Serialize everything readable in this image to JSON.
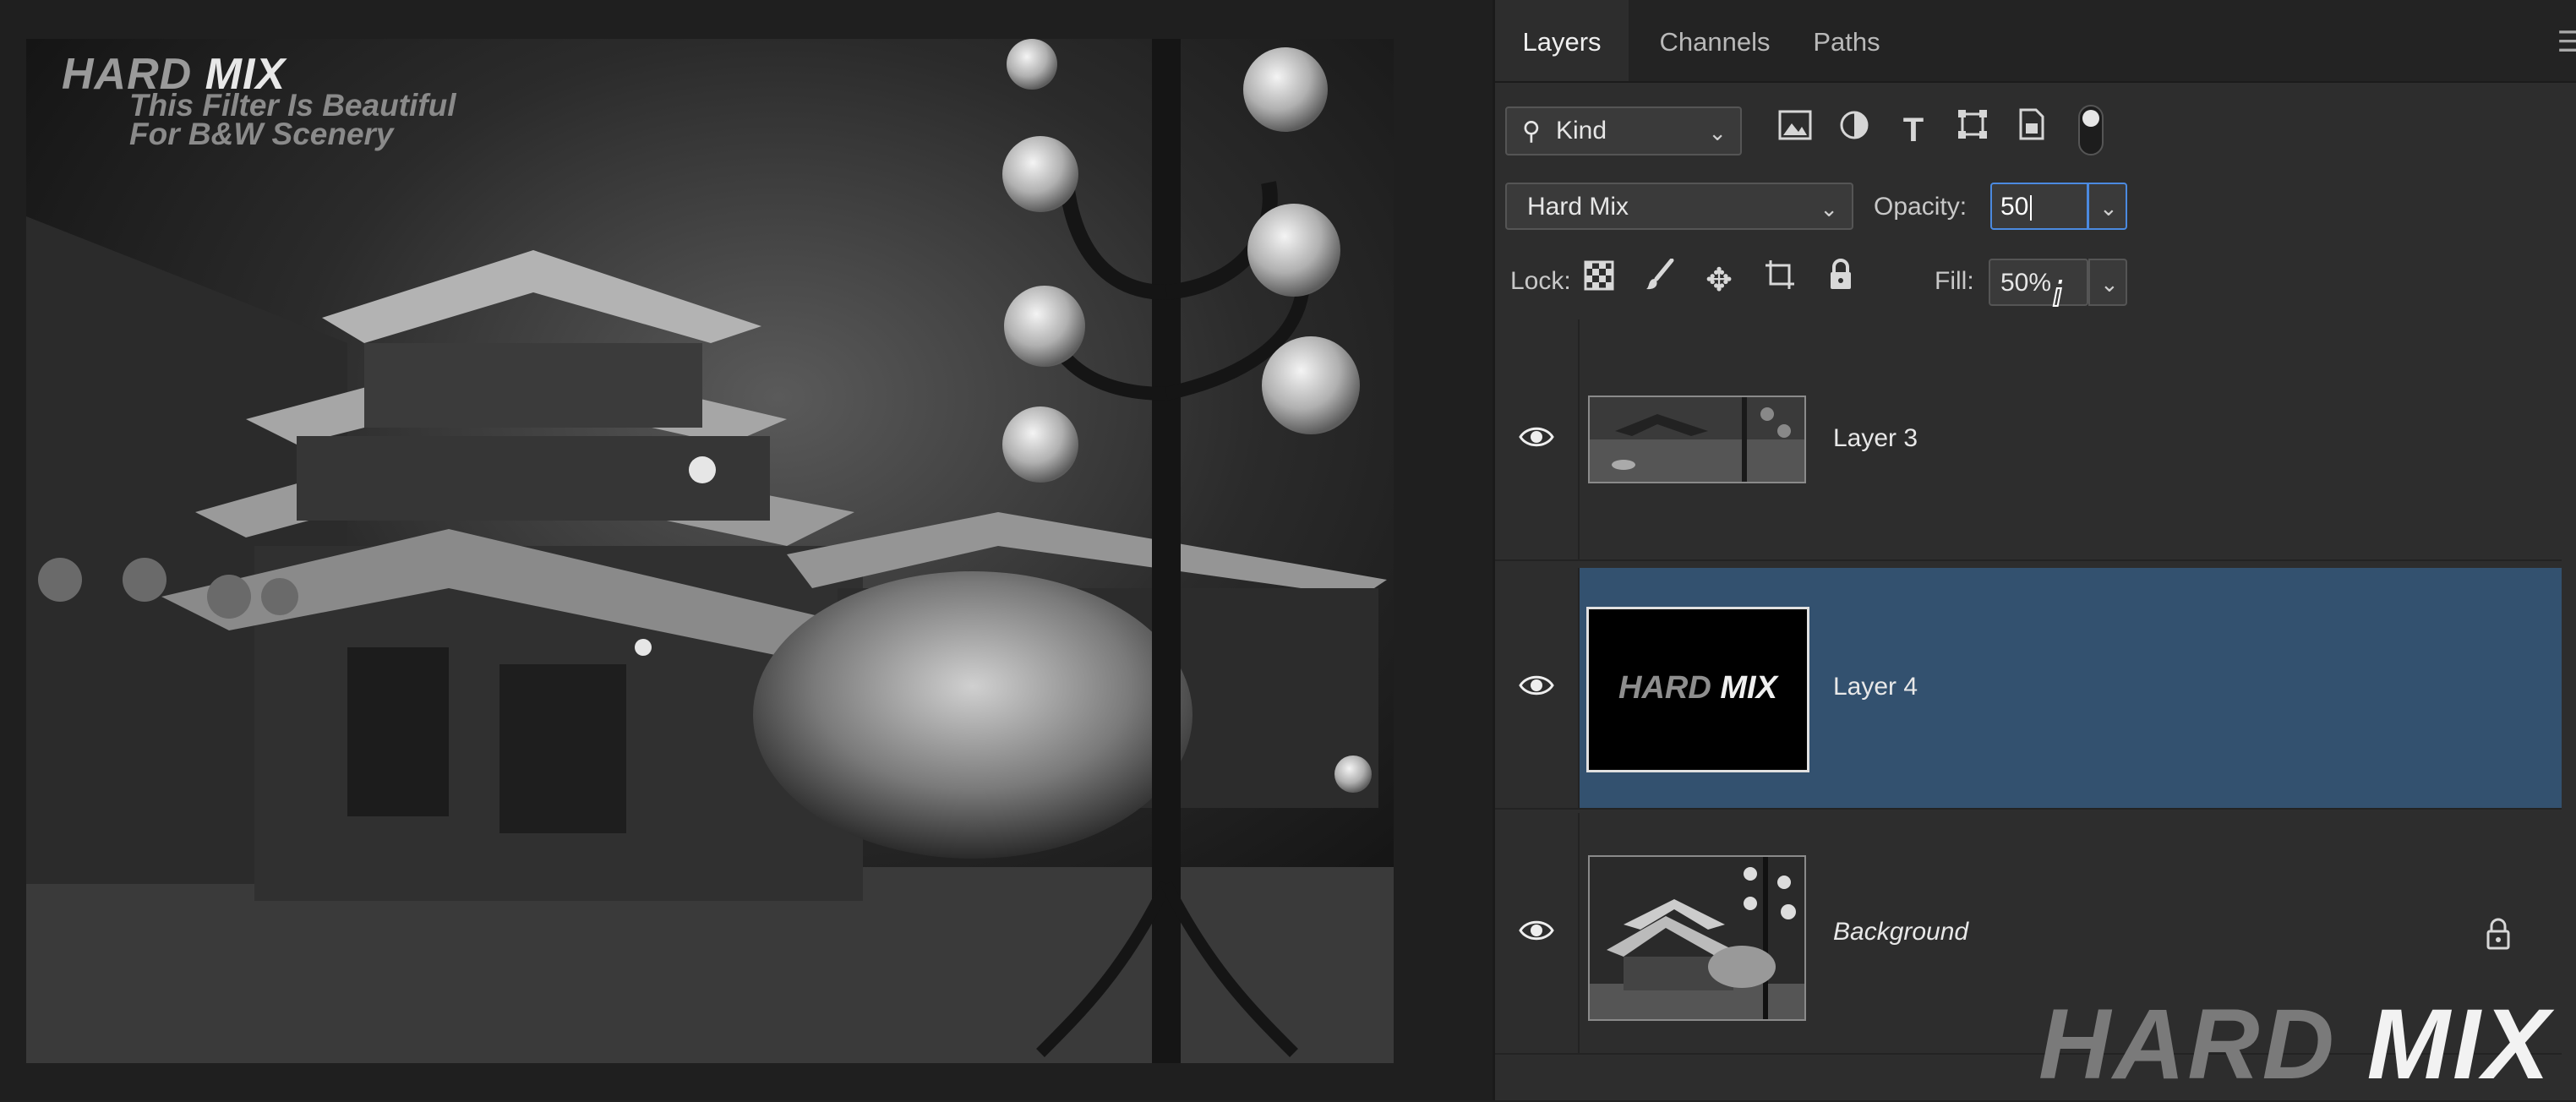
{
  "canvas": {
    "overlay": {
      "title_part1": "HARD",
      "title_part2": "MIX",
      "subtitle_line1": "This Filter Is Beautiful",
      "subtitle_line2": "For B&W Scenery"
    }
  },
  "panel": {
    "tabs": [
      {
        "label": "Layers",
        "active": true
      },
      {
        "label": "Channels",
        "active": false
      },
      {
        "label": "Paths",
        "active": false
      }
    ],
    "filter": {
      "kind_label": "Kind",
      "icons": [
        "image-filter-icon",
        "adjustment-filter-icon",
        "type-filter-icon",
        "shape-filter-icon",
        "smart-object-filter-icon"
      ]
    },
    "blend_mode": "Hard Mix",
    "opacity_label": "Opacity:",
    "opacity_value": "50",
    "lock_label": "Lock:",
    "fill_label": "Fill:",
    "fill_value": "50%",
    "layers": [
      {
        "name": "Layer 3",
        "visible": true,
        "selected": false
      },
      {
        "name": "Layer 4",
        "visible": true,
        "selected": true,
        "thumb_text_part1": "HARD",
        "thumb_text_part2": "MIX"
      },
      {
        "name": "Background",
        "visible": true,
        "selected": false,
        "locked": true
      }
    ]
  },
  "watermark": {
    "part1": "HARD",
    "part2": "MIX"
  },
  "colors": {
    "selected_row": "#33516f",
    "focus_border": "#4b8ae0",
    "panel_bg": "#2d2d2d"
  }
}
